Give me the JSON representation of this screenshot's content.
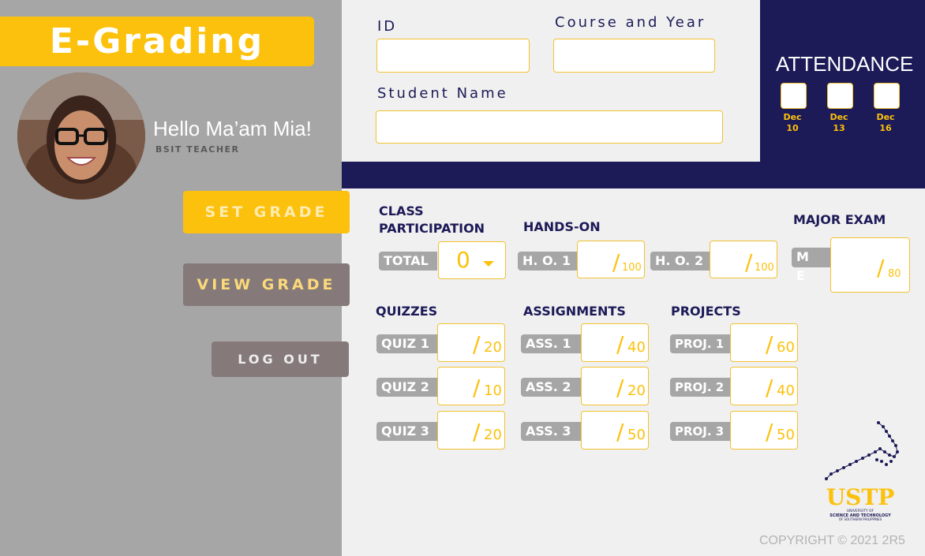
{
  "app": {
    "brand": "E-Grading"
  },
  "user": {
    "greeting": "Hello Ma’am Mia!",
    "role": "BSIT TEACHER"
  },
  "nav": {
    "set_grade": "SET GRADE",
    "view_grade": "VIEW GRADE",
    "logout": "LOG OUT"
  },
  "student": {
    "id_label": "ID",
    "id_value": "",
    "course_label": "Course and Year",
    "course_value": "",
    "name_label": "Student Name",
    "name_value": ""
  },
  "attendance": {
    "title": "ATTENDANCE",
    "days": [
      {
        "month": "Dec",
        "day": "10",
        "checked": false
      },
      {
        "month": "Dec",
        "day": "13",
        "checked": false
      },
      {
        "month": "Dec",
        "day": "16",
        "checked": false
      }
    ]
  },
  "class_participation": {
    "title_line1": "CLASS",
    "title_line2": "PARTICIPATION",
    "total_label": "TOTAL",
    "total_value": "0"
  },
  "hands_on": {
    "title": "HANDS-ON",
    "items": [
      {
        "label": "H. O. 1",
        "max": "100"
      },
      {
        "label": "H. O. 2",
        "max": "100"
      }
    ]
  },
  "major_exam": {
    "title": "MAJOR EXAM",
    "label": "M E",
    "max": "80"
  },
  "quizzes": {
    "title": "QUIZZES",
    "items": [
      {
        "label": "QUIZ 1",
        "max": "20"
      },
      {
        "label": "QUIZ 2",
        "max": "10"
      },
      {
        "label": "QUIZ 3",
        "max": "20"
      }
    ]
  },
  "assignments": {
    "title": "ASSIGNMENTS",
    "items": [
      {
        "label": "ASS. 1",
        "max": "40"
      },
      {
        "label": "ASS. 2",
        "max": "20"
      },
      {
        "label": "ASS. 3",
        "max": "50"
      }
    ]
  },
  "projects": {
    "title": "PROJECTS",
    "items": [
      {
        "label": "PROJ. 1",
        "max": "60"
      },
      {
        "label": "PROJ. 2",
        "max": "40"
      },
      {
        "label": "PROJ. 3",
        "max": "50"
      }
    ]
  },
  "logo": {
    "name": "USTP",
    "line1": "UNIVERSITY OF",
    "line2": "SCIENCE AND TECHNOLOGY",
    "line3": "OF SOUTHERN PHILIPPINES"
  },
  "footer": {
    "copyright": "COPYRIGHT © 2021 2R5"
  },
  "colors": {
    "navy": "#1c1a57",
    "gold": "#fcc10d",
    "sidebar": "#a6a6a6",
    "button_gray": "#857a79"
  }
}
